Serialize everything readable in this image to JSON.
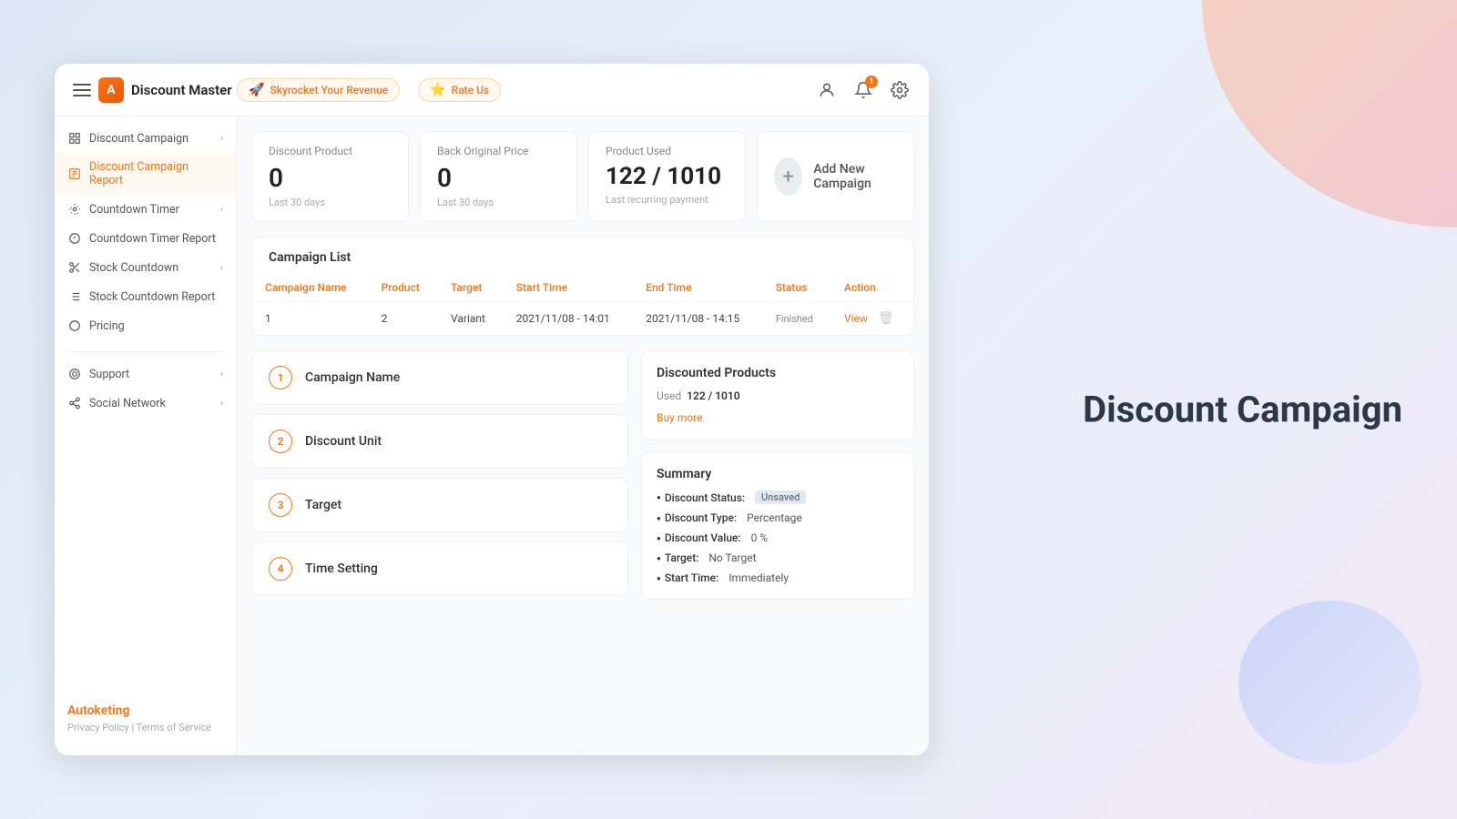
{
  "page": {
    "bg_title": "Discount Campaign"
  },
  "topbar": {
    "logo_text": "Discount Master",
    "logo_initial": "A",
    "nav_skyrocket": "Skyrocket Your Revenue",
    "nav_rate": "Rate Us",
    "notif_count": "1"
  },
  "sidebar": {
    "items": [
      {
        "id": "discount-campaign",
        "label": "Discount Campaign",
        "icon": "grid",
        "has_chevron": true,
        "active": false
      },
      {
        "id": "discount-campaign-report",
        "label": "Discount Campaign Report",
        "icon": "report",
        "has_chevron": false,
        "active": true
      },
      {
        "id": "countdown-timer",
        "label": "Countdown Timer",
        "icon": "settings",
        "has_chevron": true,
        "active": false
      },
      {
        "id": "countdown-timer-report",
        "label": "Countdown Timer Report",
        "icon": "report2",
        "has_chevron": false,
        "active": false
      },
      {
        "id": "stock-countdown",
        "label": "Stock Countdown",
        "icon": "scissors",
        "has_chevron": true,
        "active": false
      },
      {
        "id": "stock-countdown-report",
        "label": "Stock Countdown Report",
        "icon": "report3",
        "has_chevron": false,
        "active": false
      },
      {
        "id": "pricing",
        "label": "Pricing",
        "icon": "circle",
        "has_chevron": false,
        "active": false
      }
    ],
    "divider_after": 6,
    "bottom_items": [
      {
        "id": "support",
        "label": "Support",
        "has_chevron": true
      },
      {
        "id": "social-network",
        "label": "Social Network",
        "has_chevron": true
      }
    ],
    "brand": "Autoketing",
    "privacy_policy": "Privacy Policy",
    "terms": "Terms of Service"
  },
  "stats": {
    "discount_product": {
      "label": "Discount Product",
      "value": "0",
      "sub": "Last 30 days"
    },
    "back_original": {
      "label": "Back Original Price",
      "value": "0",
      "sub": "Last 30 days"
    },
    "product_used": {
      "label": "Product Used",
      "value": "122 / 1010",
      "sub": "Last recurring payment"
    },
    "add_campaign": {
      "label": "Add New Campaign"
    }
  },
  "campaign_list": {
    "title": "Campaign List",
    "columns": [
      "Campaign Name",
      "Product",
      "Target",
      "Start Time",
      "End Time",
      "Status",
      "Action"
    ],
    "rows": [
      {
        "name": "1",
        "product": "2",
        "target": "Variant",
        "start_time": "2021/11/08 - 14:01",
        "end_time": "2021/11/08 - 14:15",
        "status": "Finished",
        "action_view": "View"
      }
    ]
  },
  "form_steps": [
    {
      "number": "1",
      "label": "Campaign Name"
    },
    {
      "number": "2",
      "label": "Discount Unit"
    },
    {
      "number": "3",
      "label": "Target"
    },
    {
      "number": "4",
      "label": "Time Setting"
    }
  ],
  "discounted_products": {
    "title": "Discounted Products",
    "used_label": "Used",
    "used_value": "122 / 1010",
    "buy_more": "Buy more"
  },
  "summary": {
    "title": "Summary",
    "items": [
      {
        "key": "Discount Status:",
        "value": "Unsaved",
        "is_badge": true
      },
      {
        "key": "Discount Type:",
        "value": "Percentage",
        "is_badge": false
      },
      {
        "key": "Discount Value:",
        "value": "0 %",
        "is_badge": false
      },
      {
        "key": "Target:",
        "value": "No Target",
        "is_badge": false
      },
      {
        "key": "Start Time:",
        "value": "Immediately",
        "is_badge": false
      }
    ]
  }
}
